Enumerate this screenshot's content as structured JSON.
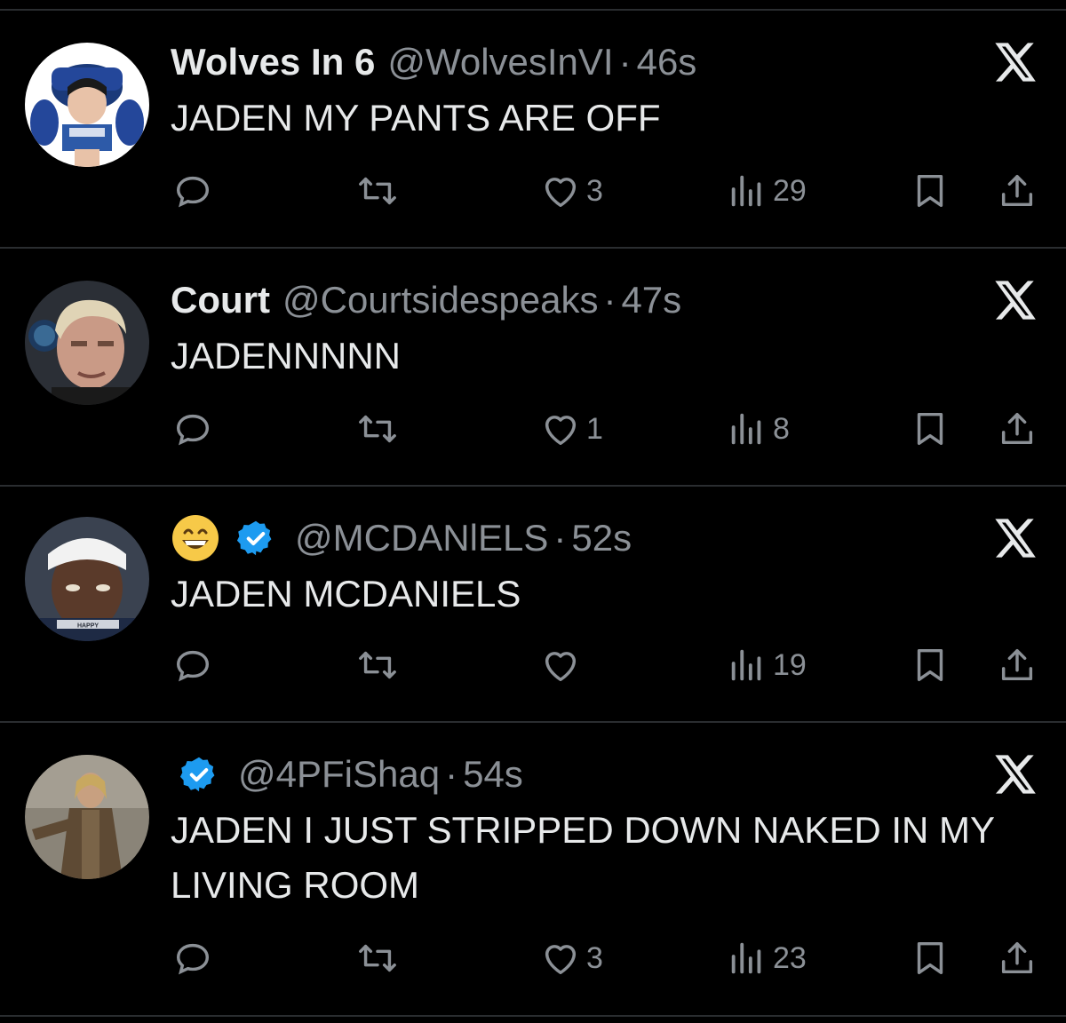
{
  "tweets": [
    {
      "name": "Wolves In 6",
      "handle": "@WolvesInVI",
      "dot": "·",
      "time": "46s",
      "text": "JADEN MY PANTS ARE OFF",
      "likes": "3",
      "views": "29",
      "verified": false,
      "emoji": false
    },
    {
      "name": "Court",
      "handle": "@Courtsidespeaks",
      "dot": "·",
      "time": "47s",
      "text": "JADENNNNN",
      "likes": "1",
      "views": "8",
      "verified": false,
      "emoji": false
    },
    {
      "name": "",
      "handle": "@MCDANlELS",
      "dot": "·",
      "time": "52s",
      "text": "JADEN MCDANIELS",
      "likes": "",
      "views": "19",
      "verified": true,
      "emoji": true
    },
    {
      "name": "",
      "handle": "@4PFiShaq",
      "dot": "·",
      "time": "54s",
      "text": "JADEN I JUST STRIPPED DOWN NAKED IN MY LIVING ROOM",
      "likes": "3",
      "views": "23",
      "verified": true,
      "emoji": false
    }
  ],
  "avatar3_label": "HAPPY",
  "icons": {
    "close": "x-logo-icon",
    "reply": "reply-icon",
    "retweet": "retweet-icon",
    "like": "heart-icon",
    "views": "views-icon",
    "bookmark": "bookmark-icon",
    "share": "share-icon",
    "verified": "verified-badge-icon",
    "emoji": "grinning-emoji-icon"
  },
  "colors": {
    "background": "#000000",
    "text": "#e7e9ea",
    "muted": "#8b9096",
    "verified": "#1d9bf0"
  }
}
